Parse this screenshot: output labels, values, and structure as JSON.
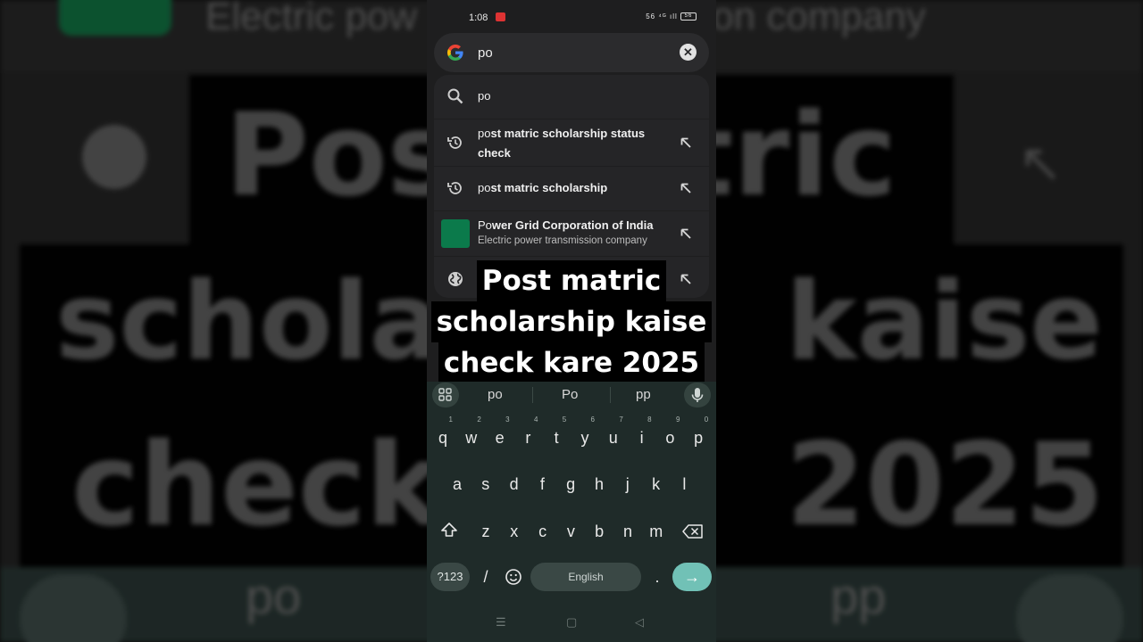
{
  "status": {
    "time": "1:08",
    "net": "56 ⁴ᴳ ıll",
    "battery": "56"
  },
  "search": {
    "query": "po",
    "clear_label": "✕"
  },
  "suggestions": [
    {
      "prefix": "po",
      "rest": "",
      "sub": ""
    },
    {
      "prefix": "po",
      "rest": "st matric scholarship status check",
      "sub": ""
    },
    {
      "prefix": "po",
      "rest": "st matric scholarship",
      "sub": ""
    },
    {
      "prefix": "Po",
      "rest": "wer Grid Corporation of India",
      "sub": "Electric power transmission company"
    }
  ],
  "caption": {
    "line1": "Post matric",
    "line2": "scholarship kaise",
    "line3": "check kare 2025"
  },
  "background": {
    "top_text": "Electric pow",
    "top_text2": "on company",
    "big1a": "Pos",
    "big1b": "tric",
    "big2a": "schola",
    "big2b": "kaise",
    "big3a": "check",
    "big3b": "2025",
    "bottom_po": "po",
    "bottom_pp": "pp"
  },
  "keyboard": {
    "suggestions": [
      "po",
      "Po",
      "pp"
    ],
    "row1": [
      "q",
      "w",
      "e",
      "r",
      "t",
      "y",
      "u",
      "i",
      "o",
      "p"
    ],
    "row1_nums": [
      "1",
      "2",
      "3",
      "4",
      "5",
      "6",
      "7",
      "8",
      "9",
      "0"
    ],
    "row2": [
      "a",
      "s",
      "d",
      "f",
      "g",
      "h",
      "j",
      "k",
      "l"
    ],
    "row3": [
      "z",
      "x",
      "c",
      "v",
      "b",
      "n",
      "m"
    ],
    "symbols_label": "?123",
    "slash_label": "/",
    "space_label": "English",
    "period_label": ".",
    "enter_label": "→"
  },
  "nav": {
    "menu": "☰",
    "home": "▢",
    "back": "◁"
  },
  "icons": {
    "search": "search-icon",
    "history": "history-icon",
    "globe": "globe-icon",
    "fill": "arrow-up-left-icon"
  },
  "colors": {
    "enter": "#71c1b6",
    "tile": "#0b7a4b",
    "keyboard": "#1f2b29"
  }
}
